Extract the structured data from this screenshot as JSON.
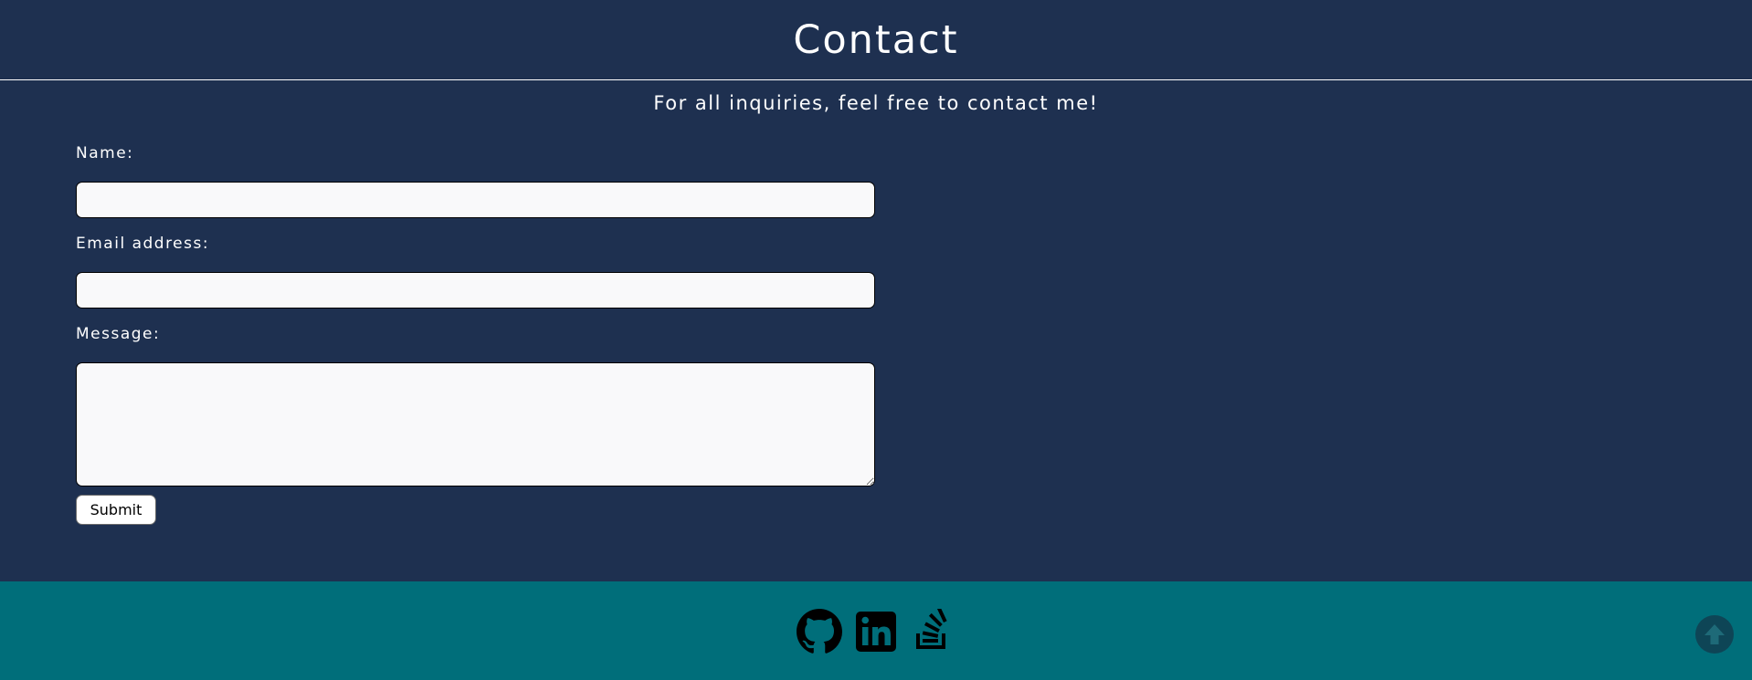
{
  "header": {
    "title": "Contact"
  },
  "intro": {
    "text": "For all inquiries, feel free to contact me!"
  },
  "form": {
    "name_label": "Name:",
    "name_value": "",
    "email_label": "Email address:",
    "email_value": "",
    "message_label": "Message:",
    "message_value": "",
    "submit_label": "Submit"
  },
  "footer": {
    "social_icons": [
      "github-icon",
      "linkedin-icon",
      "stack-overflow-icon"
    ],
    "back_to_top_icon": "arrow-circle-up-icon"
  },
  "colors": {
    "page_background": "#1e3050",
    "footer_background": "#006e7a",
    "input_background": "#f9f9fa",
    "back_to_top_background": "#0e4556",
    "text": "#ffffff"
  }
}
